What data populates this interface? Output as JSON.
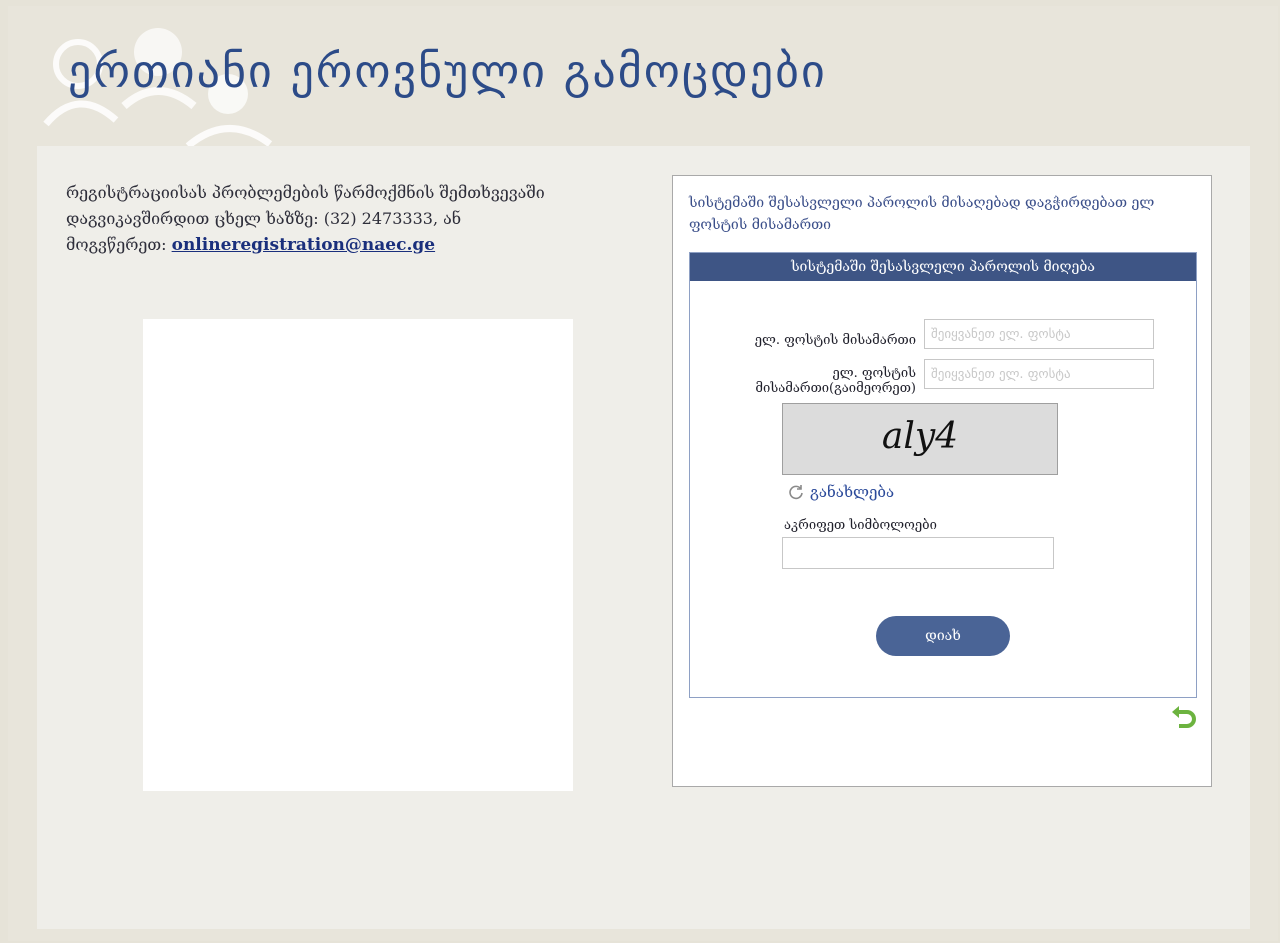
{
  "header": {
    "title": "ერთიანი ეროვნული გამოცდები"
  },
  "help": {
    "line1": "რეგისტრაციისას პრობლემების წარმოქმნის შემთხვევაში",
    "line2": "დაგვიკავშირდით  ცხელ ხაზზე: (32) 2473333, ან",
    "line3_prefix": "მოგვწერეთ: ",
    "email": "onlineregistration@naec.ge"
  },
  "reset_box": {
    "intro": "სისტემაში შესასვლელი პაროლის მისაღებად დაგჭირდებათ ელ ფოსტის მისამართი",
    "form_title": "სისტემაში შესასვლელი პაროლის მიღება",
    "email_label": "ელ. ფოსტის მისამართი",
    "email_placeholder": "შეიყვანეთ ელ. ფოსტა",
    "email_value": "",
    "confirm_label_line1": "ელ. ფოსტის",
    "confirm_label_line2": "მისამართი(გაიმეორეთ)",
    "confirm_placeholder": "შეიყვანეთ ელ. ფოსტა",
    "confirm_value": "",
    "captcha_text": "aly4",
    "refresh_label": "განახლება",
    "symbols_label": "აკრიფეთ სიმბოლოები",
    "symbols_value": "",
    "submit_label": "დიახ"
  },
  "colors": {
    "title": "#2c4b88",
    "form_header": "#3e5585",
    "button": "#4a6496",
    "back_arrow": "#6cb33f"
  },
  "icons": [
    "people-logo-icon",
    "refresh-icon",
    "back-arrow-icon"
  ]
}
